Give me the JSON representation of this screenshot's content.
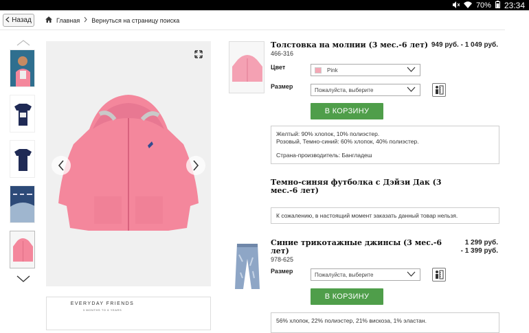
{
  "status": {
    "battery": "70%",
    "time": "23:34"
  },
  "nav": {
    "back_label": "Назад",
    "crumbs": [
      "Главная",
      "Вернуться на страницу поиска"
    ]
  },
  "products": [
    {
      "title": "Толстовка на молнии (3 мес.-6 лет)",
      "code": "466-316",
      "price": "949 руб. - 1 049 руб.",
      "color_label": "Цвет",
      "color_value": "Pink",
      "size_label": "Размер",
      "size_placeholder": "Пожалуйста, выберите",
      "cart_label": "В КОРЗИНУ",
      "info_lines": [
        "Желтый: 90% хлопок, 10% полиэстер.",
        "Розовый, Темно-синий: 60% хлопок, 40% полиэстер.",
        "Страна-производитель: Бангладеш"
      ]
    },
    {
      "title_line1": "Темно-синяя футболка с Дэйзи Дак (3",
      "title_line2": "мес.-6 лет)",
      "unavailable": "К сожалению, в настоящий момент заказать данный товар нельзя."
    },
    {
      "title_line1": "Синие трикотажные джинсы (3 мес.-6",
      "title_line2": "лет)",
      "code": "978-625",
      "price_line1": "1 299 руб.",
      "price_line2": "- 1 399 руб.",
      "size_label": "Размер",
      "size_placeholder": "Пожалуйста, выберите",
      "cart_label": "В КОРЗИНУ",
      "info_line": "56% хлопок, 22% полиэстер, 21% вискоза, 1% эластан."
    }
  ],
  "banner": {
    "title": "EVERYDAY FRIENDS",
    "subtitle": "3 MONTHS TO 6 YEARS"
  },
  "colors": {
    "accent_green": "#4f9e4a",
    "product_pink": "#f4879c",
    "navy": "#1f2a55"
  }
}
